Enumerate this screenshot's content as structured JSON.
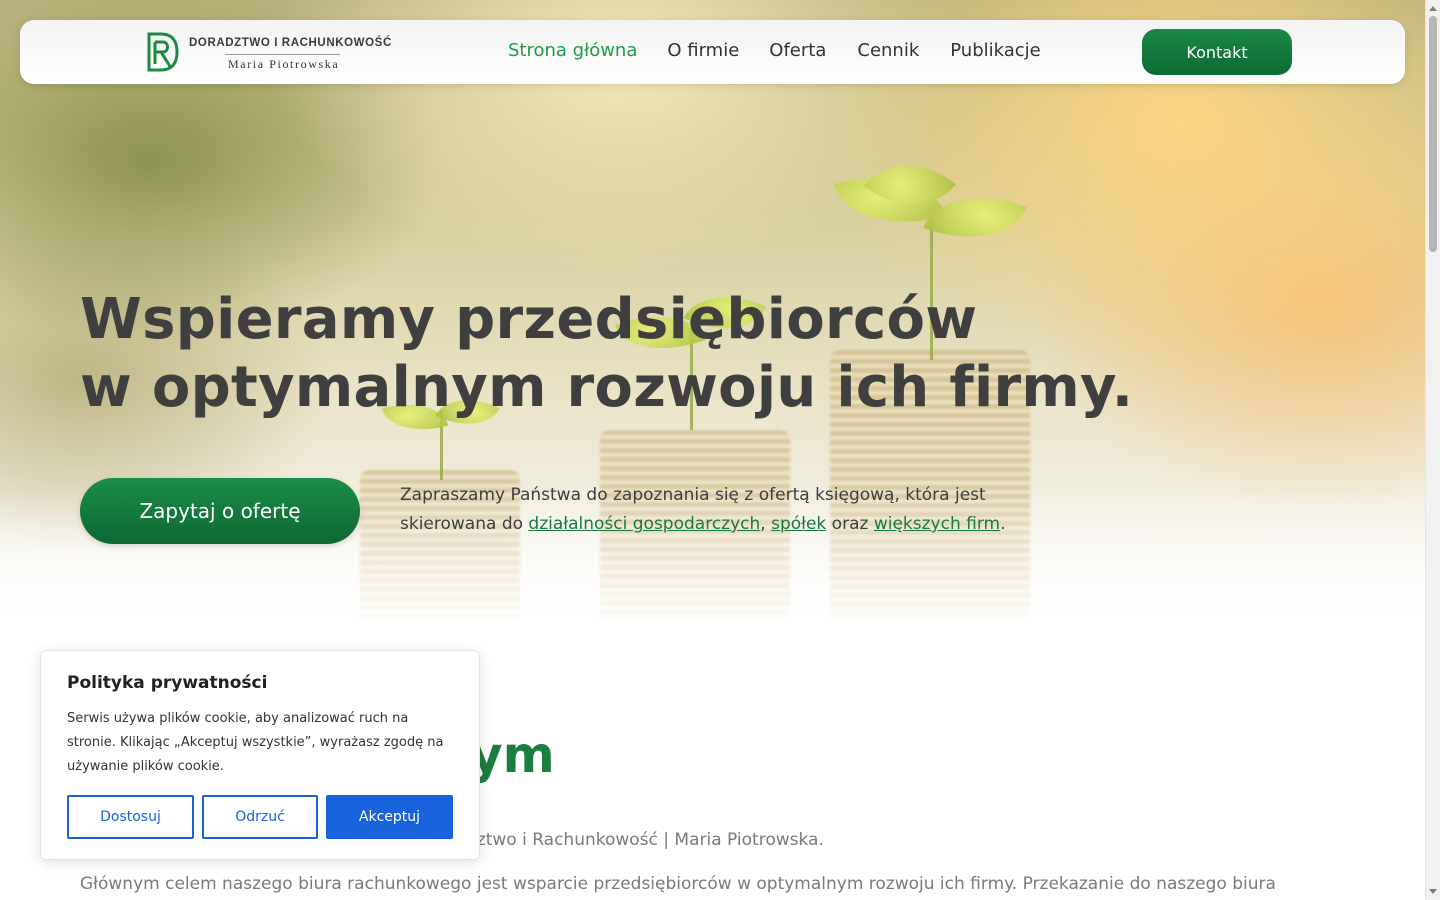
{
  "header": {
    "logo": {
      "title": "DORADZTWO I RACHUNKOWOŚĆ",
      "subtitle": "Maria Piotrowska"
    },
    "nav": [
      {
        "label": "Strona główna",
        "active": true
      },
      {
        "label": "O firmie",
        "active": false
      },
      {
        "label": "Oferta",
        "active": false
      },
      {
        "label": "Cennik",
        "active": false
      },
      {
        "label": "Publikacje",
        "active": false
      }
    ],
    "contact_button": "Kontakt"
  },
  "hero": {
    "title_line1": "Wspieramy przedsiębiorców",
    "title_line2": "w optymalnym rozwoju ich firmy.",
    "cta_button": "Zapytaj o ofertę",
    "desc_part1": "Zapraszamy Państwa do zapoznania się z ofertą księgową, która jest skierowana do ",
    "desc_link1": "działalności gospodarczych",
    "desc_sep1": ", ",
    "desc_link2": "spółek",
    "desc_sep2": " oraz ",
    "desc_link3": "większych firm",
    "desc_end": "."
  },
  "content": {
    "heading_visible": "ym",
    "para1_visible": "dztwo i Rachunkowość | Maria Piotrowska.",
    "para2": "Głównym celem naszego biura rachunkowego jest wsparcie przedsiębiorców w optymalnym rozwoju ich firmy. Przekazanie do naszego biura"
  },
  "cookie_popup": {
    "title": "Polityka prywatności",
    "text": "Serwis używa plików cookie, aby analizować ruch na stronie. Klikając „Akceptuj wszystkie”, wyrażasz zgodę na używanie plików cookie.",
    "buttons": {
      "customize": "Dostosuj",
      "reject": "Odrzuć",
      "accept": "Akceptuj"
    }
  },
  "colors": {
    "brand_green": "#1a8a44",
    "nav_active": "#1f9a45",
    "cookie_blue": "#1863dc"
  }
}
